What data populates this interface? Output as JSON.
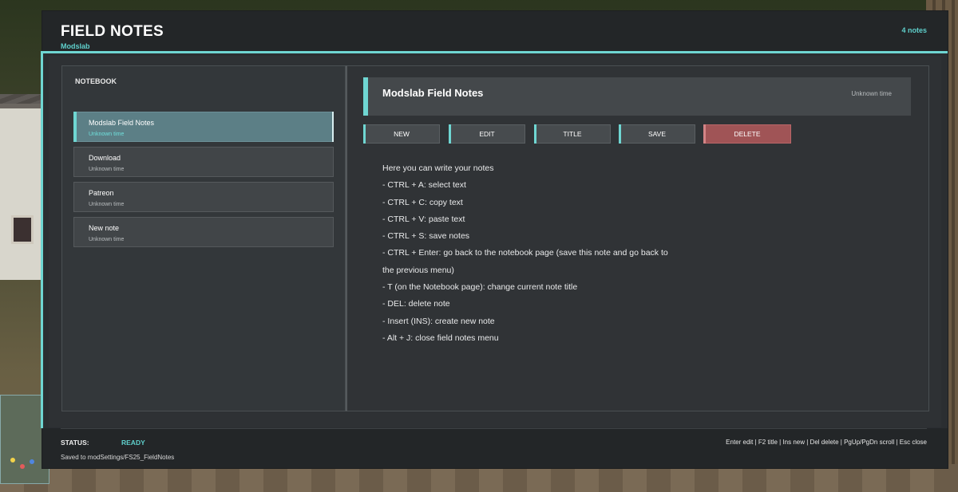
{
  "header": {
    "title": "FIELD NOTES",
    "subtitle": "Modslab",
    "note_count": "4 notes"
  },
  "notebook": {
    "label": "NOTEBOOK",
    "items": [
      {
        "title": "Modslab Field Notes",
        "time": "Unknown time",
        "active": true
      },
      {
        "title": "Download",
        "time": "Unknown time",
        "active": false
      },
      {
        "title": "Patreon",
        "time": "Unknown time",
        "active": false
      },
      {
        "title": "New note",
        "time": "Unknown time",
        "active": false
      }
    ]
  },
  "editor": {
    "title": "Modslab Field Notes",
    "time": "Unknown time",
    "toolbar": {
      "new_label": "NEW",
      "edit_label": "EDIT",
      "title_label": "TITLE",
      "save_label": "SAVE",
      "delete_label": "DELETE"
    },
    "body_lines": [
      "Here you can write your notes",
      "- CTRL + A: select text",
      "- CTRL + C: copy text",
      "- CTRL + V: paste text",
      "- CTRL + S: save notes",
      "- CTRL + Enter: go back to the notebook page (save this note and go back to",
      "the previous menu)",
      "- T (on the Notebook page): change current note title",
      "- DEL: delete note",
      "- Insert (INS): create new note",
      "- Alt + J: close field notes menu"
    ]
  },
  "status": {
    "label": "STATUS:",
    "value": "READY",
    "saved_path": "Saved to modSettings/FS25_FieldNotes",
    "shortcuts": "Enter edit | F2 title | Ins new | Del delete | PgUp/PgDn scroll | Esc close"
  },
  "colors": {
    "accent": "#6fd6d2",
    "delete": "#a05456",
    "panel": "#2b2e31"
  }
}
